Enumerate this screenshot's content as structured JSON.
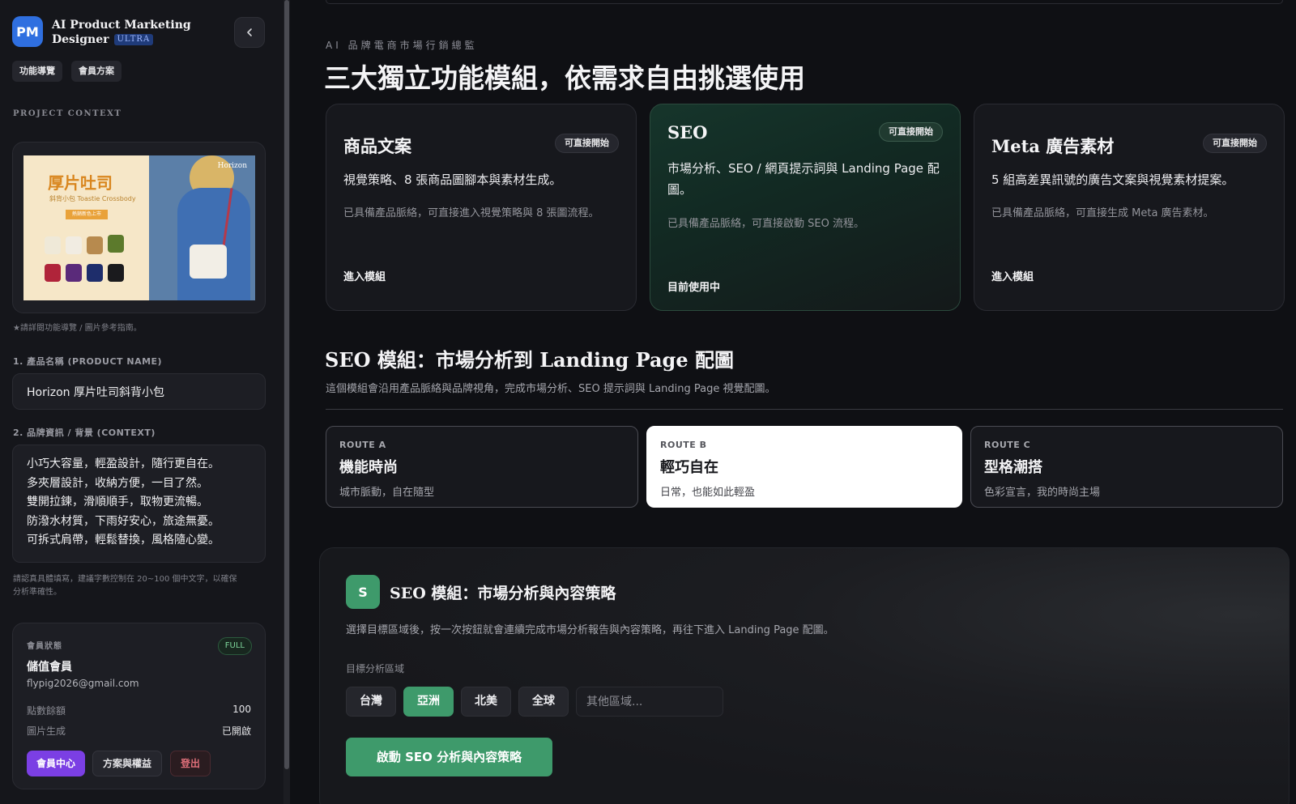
{
  "app": {
    "logo_initials": "PM",
    "title_line1": "AI Product Marketing",
    "title_line2": "Designer",
    "tier_badge": "ULTRA",
    "collapse_icon": "chevron-left-icon"
  },
  "sidebar": {
    "nav_chips": [
      "功能導覽",
      "會員方案"
    ],
    "section_label": "PROJECT CONTEXT",
    "product_image": {
      "headline": "厚片吐司",
      "subline": "斜背小包 Toastie Crossbody",
      "tag": "熱銷新色上市",
      "brand": "Horizon"
    },
    "image_note": "★請詳閱功能導覽 / 圖片參考指南。",
    "product_name_label": "1. 產品名稱 (PRODUCT NAME)",
    "product_name_value": "Horizon 厚片吐司斜背小包",
    "context_label": "2. 品牌資訊 / 背景 (CONTEXT)",
    "context_lines": [
      "小巧大容量，輕盈設計，隨行更自在。",
      "多夾層設計，收納方便，一目了然。",
      "雙開拉鍊，滑順順手，取物更流暢。",
      "防潑水材質，下雨好安心，旅途無憂。",
      "可拆式肩帶，輕鬆替換，風格隨心變。"
    ],
    "context_hint_line1": "請認真具體填寫，建議字數控制在 20~100 個中文字，以確保",
    "context_hint_line2": "分析準確性。",
    "member": {
      "status_label": "會員狀態",
      "plan_badge": "FULL",
      "tier": "儲值會員",
      "email": "flypig2026@gmail.com",
      "points_label": "點數餘額",
      "points_value": "100",
      "image_gen_label": "圖片生成",
      "image_gen_value": "已開啟",
      "btn_center": "會員中心",
      "btn_plans": "方案與權益",
      "btn_logout": "登出"
    }
  },
  "main": {
    "eyebrow": "AI 品牌電商市場行銷總監",
    "heading": "三大獨立功能模組，依需求自由挑選使用",
    "modules": [
      {
        "title": "商品文案",
        "badge": "可直接開始",
        "desc": "視覺策略、8 張商品圖腳本與素材生成。",
        "note": "已具備產品脈絡，可直接進入視覺策略與 8 張圖流程。",
        "link": "進入模組"
      },
      {
        "title": "SEO",
        "badge": "可直接開始",
        "desc": "市場分析、SEO / 網頁提示詞與 Landing Page 配圖。",
        "note": "已具備產品脈絡，可直接啟動 SEO 流程。",
        "link": "目前使用中"
      },
      {
        "title": "Meta 廣告素材",
        "badge": "可直接開始",
        "desc": "5 組高差異訊號的廣告文案與視覺素材提案。",
        "note": "已具備產品脈絡，可直接生成 Meta 廣告素材。",
        "link": "進入模組"
      }
    ],
    "seo_heading": "SEO 模組：市場分析到 Landing Page 配圖",
    "seo_subheading": "這個模組會沿用產品脈絡與品牌視角，完成市場分析、SEO 提示詞與 Landing Page 視覺配圖。",
    "routes": [
      {
        "key": "ROUTE A",
        "title": "機能時尚",
        "subtitle": "城市脈動，自在隨型"
      },
      {
        "key": "ROUTE B",
        "title": "輕巧自在",
        "subtitle": "日常，也能如此輕盈"
      },
      {
        "key": "ROUTE C",
        "title": "型格潮搭",
        "subtitle": "色彩宣言，我的時尚主場"
      }
    ],
    "selected_route": "ROUTE B",
    "seo_panel": {
      "badge": "S",
      "title": "SEO 模組：市場分析與內容策略",
      "desc": "選擇目標區域後，按一次按鈕就會連續完成市場分析報告與內容策略，再往下進入 Landing Page 配圖。",
      "region_label": "目標分析區域",
      "regions": [
        "台灣",
        "亞洲",
        "北美",
        "全球"
      ],
      "selected_region": "亞洲",
      "other_region_placeholder": "其他區域...",
      "start_button": "啟動 SEO 分析與內容策略"
    }
  },
  "colors": {
    "accent_green": "#3e9a6b",
    "brand_blue": "#2f6fe0",
    "member_purple": "#7b3fe4",
    "logout_red": "#e0707a"
  }
}
